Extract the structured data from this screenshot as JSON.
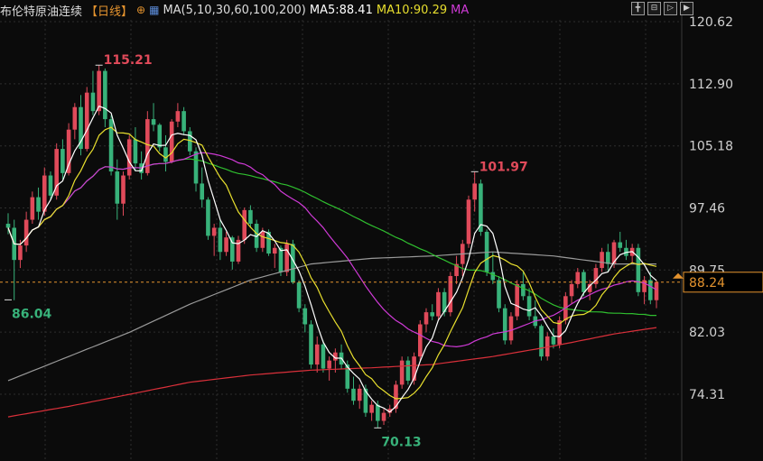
{
  "header": {
    "instrument": "布伦特原油连续",
    "period": "【日线】",
    "ma_settings": "MA(5,10,30,60,100,200)",
    "ma5_label": "MA5:88.41",
    "ma10_label": "MA10:90.29",
    "ma_more": "MA"
  },
  "colors": {
    "background": "#0b0b0b",
    "up": "#e04a5a",
    "down": "#38b27a",
    "ma5": "#ffffff",
    "ma10": "#e8df2e",
    "ma30": "#cf3ad6",
    "ma60": "#2fbf2f",
    "ma100": "#9a9a9a",
    "ma200": "#d9303a",
    "price_line": "#e4932e"
  },
  "chart_data": {
    "type": "candlestick",
    "y_ticks": [
      "120.62",
      "112.90",
      "105.18",
      "97.46",
      "89.75",
      "82.03",
      "74.31"
    ],
    "y_tick_values": [
      120.62,
      112.9,
      105.18,
      97.46,
      89.75,
      82.03,
      74.31
    ],
    "current_price": "88.24",
    "annotations": [
      {
        "text": "115.21",
        "value": 115.21,
        "kind": "high"
      },
      {
        "text": "86.04",
        "value": 86.04,
        "kind": "low"
      },
      {
        "text": "101.97",
        "value": 101.97,
        "kind": "high"
      },
      {
        "text": "70.13",
        "value": 70.13,
        "kind": "low"
      }
    ],
    "candles": [
      [
        95.5,
        96.8,
        94.2,
        95.0
      ],
      [
        95.0,
        96.0,
        86.0,
        91.0
      ],
      [
        91.0,
        93.5,
        90.0,
        92.8
      ],
      [
        92.8,
        97.0,
        92.0,
        96.0
      ],
      [
        96.0,
        99.5,
        95.5,
        98.8
      ],
      [
        98.8,
        100.0,
        96.0,
        97.0
      ],
      [
        97.0,
        102.5,
        96.5,
        101.5
      ],
      [
        101.5,
        102.0,
        98.5,
        99.0
      ],
      [
        99.0,
        105.5,
        98.5,
        104.8
      ],
      [
        104.8,
        106.0,
        101.0,
        101.8
      ],
      [
        101.8,
        108.0,
        101.5,
        107.2
      ],
      [
        107.2,
        110.5,
        106.0,
        110.0
      ],
      [
        110.0,
        111.5,
        104.0,
        104.8
      ],
      [
        104.8,
        112.5,
        104.5,
        111.8
      ],
      [
        111.8,
        114.5,
        109.0,
        109.5
      ],
      [
        109.5,
        115.21,
        109.0,
        114.5
      ],
      [
        114.5,
        114.8,
        107.5,
        108.5
      ],
      [
        108.5,
        109.0,
        101.5,
        102.0
      ],
      [
        102.0,
        103.5,
        96.0,
        98.0
      ],
      [
        98.0,
        102.0,
        96.5,
        101.5
      ],
      [
        101.5,
        106.5,
        101.0,
        106.0
      ],
      [
        106.0,
        107.5,
        102.0,
        103.0
      ],
      [
        103.0,
        104.5,
        101.0,
        101.8
      ],
      [
        101.8,
        109.5,
        101.5,
        108.5
      ],
      [
        108.5,
        110.5,
        107.0,
        107.8
      ],
      [
        107.8,
        108.0,
        104.5,
        105.0
      ],
      [
        105.0,
        106.5,
        102.0,
        103.2
      ],
      [
        103.2,
        108.5,
        103.0,
        108.2
      ],
      [
        108.2,
        110.5,
        107.5,
        109.5
      ],
      [
        109.5,
        110.0,
        106.5,
        107.0
      ],
      [
        107.0,
        107.5,
        104.0,
        104.5
      ],
      [
        104.5,
        105.0,
        99.5,
        100.5
      ],
      [
        100.5,
        102.5,
        97.5,
        98.5
      ],
      [
        98.5,
        98.8,
        93.5,
        94.0
      ],
      [
        94.0,
        95.5,
        91.5,
        95.0
      ],
      [
        95.0,
        96.0,
        91.0,
        92.0
      ],
      [
        92.0,
        94.5,
        91.5,
        93.8
      ],
      [
        93.8,
        94.0,
        89.8,
        90.8
      ],
      [
        90.8,
        94.0,
        90.5,
        93.5
      ],
      [
        93.5,
        97.5,
        93.0,
        97.2
      ],
      [
        97.2,
        97.8,
        95.0,
        95.5
      ],
      [
        95.5,
        96.0,
        92.0,
        92.5
      ],
      [
        92.5,
        95.0,
        92.0,
        94.5
      ],
      [
        94.5,
        94.8,
        91.5,
        91.8
      ],
      [
        91.8,
        93.0,
        90.0,
        92.5
      ],
      [
        92.5,
        92.8,
        89.0,
        89.5
      ],
      [
        89.5,
        93.5,
        89.0,
        93.0
      ],
      [
        93.0,
        93.5,
        88.0,
        88.2
      ],
      [
        88.2,
        88.5,
        84.5,
        85.0
      ],
      [
        85.0,
        85.5,
        82.0,
        83.0
      ],
      [
        83.0,
        83.5,
        77.5,
        78.0
      ],
      [
        78.0,
        81.5,
        77.0,
        80.5
      ],
      [
        80.5,
        81.0,
        77.0,
        77.5
      ],
      [
        77.5,
        79.0,
        76.0,
        78.5
      ],
      [
        78.5,
        80.0,
        77.0,
        79.5
      ],
      [
        79.5,
        80.5,
        77.5,
        78.0
      ],
      [
        78.0,
        78.5,
        74.5,
        75.0
      ],
      [
        75.0,
        76.5,
        73.0,
        73.5
      ],
      [
        73.5,
        75.5,
        72.5,
        75.0
      ],
      [
        75.0,
        75.5,
        71.5,
        72.0
      ],
      [
        72.0,
        73.5,
        71.0,
        73.0
      ],
      [
        73.0,
        73.5,
        70.13,
        71.0
      ],
      [
        71.0,
        72.5,
        70.5,
        72.0
      ],
      [
        72.0,
        73.0,
        71.5,
        72.5
      ],
      [
        72.5,
        76.0,
        72.0,
        75.5
      ],
      [
        75.5,
        79.0,
        75.0,
        78.5
      ],
      [
        78.5,
        79.0,
        75.5,
        76.0
      ],
      [
        76.0,
        79.5,
        75.5,
        79.0
      ],
      [
        79.0,
        83.5,
        78.5,
        83.0
      ],
      [
        83.0,
        85.0,
        82.0,
        84.5
      ],
      [
        84.5,
        85.5,
        83.5,
        84.0
      ],
      [
        84.0,
        87.5,
        83.5,
        87.0
      ],
      [
        87.0,
        87.5,
        84.0,
        84.5
      ],
      [
        84.5,
        89.5,
        84.0,
        89.0
      ],
      [
        89.0,
        91.5,
        88.0,
        90.5
      ],
      [
        90.5,
        93.5,
        89.0,
        93.0
      ],
      [
        93.0,
        99.0,
        92.5,
        98.5
      ],
      [
        98.5,
        101.97,
        97.0,
        100.5
      ],
      [
        100.5,
        101.0,
        94.0,
        94.5
      ],
      [
        94.5,
        94.8,
        89.0,
        89.5
      ],
      [
        89.5,
        92.0,
        88.0,
        88.5
      ],
      [
        88.5,
        89.0,
        84.5,
        85.0
      ],
      [
        85.0,
        85.5,
        80.5,
        81.0
      ],
      [
        81.0,
        84.5,
        80.5,
        84.0
      ],
      [
        84.0,
        88.5,
        83.5,
        88.0
      ],
      [
        88.0,
        89.5,
        86.0,
        86.5
      ],
      [
        86.5,
        87.5,
        83.5,
        84.0
      ],
      [
        84.0,
        86.0,
        82.5,
        82.8
      ],
      [
        82.8,
        83.0,
        78.5,
        79.0
      ],
      [
        79.0,
        82.0,
        78.5,
        81.5
      ],
      [
        81.5,
        82.5,
        80.0,
        80.5
      ],
      [
        80.5,
        84.0,
        80.0,
        83.5
      ],
      [
        83.5,
        87.0,
        83.0,
        86.5
      ],
      [
        86.5,
        88.5,
        85.5,
        88.0
      ],
      [
        88.0,
        90.0,
        87.5,
        89.5
      ],
      [
        89.5,
        89.8,
        86.5,
        87.0
      ],
      [
        87.0,
        88.5,
        86.0,
        88.0
      ],
      [
        88.0,
        90.5,
        87.5,
        90.0
      ],
      [
        90.0,
        92.5,
        89.5,
        92.0
      ],
      [
        92.0,
        93.0,
        89.5,
        90.5
      ],
      [
        90.5,
        93.5,
        90.0,
        93.2
      ],
      [
        93.2,
        94.5,
        92.0,
        92.5
      ],
      [
        92.5,
        93.5,
        91.0,
        91.5
      ],
      [
        91.5,
        93.0,
        90.5,
        92.5
      ],
      [
        92.5,
        93.0,
        86.5,
        87.0
      ],
      [
        87.0,
        89.0,
        85.5,
        88.5
      ],
      [
        88.5,
        89.5,
        85.5,
        86.0
      ],
      [
        86.0,
        88.5,
        85.0,
        88.24
      ]
    ],
    "ma100": [
      [
        0,
        76.0
      ],
      [
        10,
        79.0
      ],
      [
        20,
        82.0
      ],
      [
        30,
        85.5
      ],
      [
        40,
        88.5
      ],
      [
        50,
        90.5
      ],
      [
        60,
        91.2
      ],
      [
        70,
        91.5
      ],
      [
        80,
        92.0
      ],
      [
        90,
        91.5
      ],
      [
        100,
        90.5
      ],
      [
        107,
        90.5
      ]
    ],
    "ma200": [
      [
        0,
        71.5
      ],
      [
        10,
        72.8
      ],
      [
        20,
        74.3
      ],
      [
        30,
        75.8
      ],
      [
        40,
        76.7
      ],
      [
        50,
        77.3
      ],
      [
        60,
        77.6
      ],
      [
        70,
        78.0
      ],
      [
        80,
        79.0
      ],
      [
        90,
        80.3
      ],
      [
        100,
        81.8
      ],
      [
        107,
        82.6
      ]
    ]
  }
}
